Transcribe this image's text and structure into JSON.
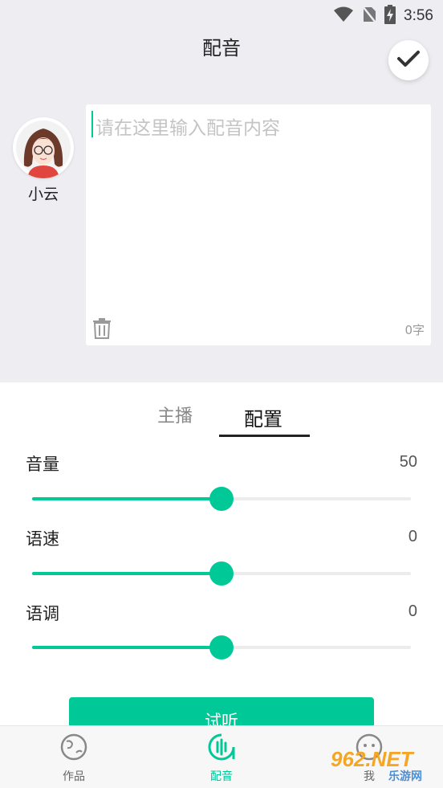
{
  "status_bar": {
    "time": "3:56"
  },
  "header": {
    "title": "配音"
  },
  "speaker": {
    "name": "小云"
  },
  "editor": {
    "placeholder": "请在这里输入配音内容",
    "char_count": "0字"
  },
  "tabs": [
    {
      "label": "主播",
      "selected": false
    },
    {
      "label": "配置",
      "selected": true
    }
  ],
  "settings": [
    {
      "label": "音量",
      "value": "50",
      "level_percent": 50
    },
    {
      "label": "语速",
      "value": "0",
      "level_percent": 50
    },
    {
      "label": "语调",
      "value": "0",
      "level_percent": 50
    }
  ],
  "preview_button": {
    "label": "试听"
  },
  "bottom_nav": [
    {
      "label": "作品",
      "icon": "planet-icon",
      "active": false
    },
    {
      "label": "配音",
      "icon": "sound-wave-icon",
      "active": true
    },
    {
      "label": "我",
      "icon": "smiley-icon",
      "active": false
    }
  ],
  "watermark": {
    "main": "962.NET",
    "sub": "乐游网"
  },
  "colors": {
    "accent": "#00c896",
    "top_background": "#eeedf2",
    "nav_background": "#f7f7f7"
  }
}
